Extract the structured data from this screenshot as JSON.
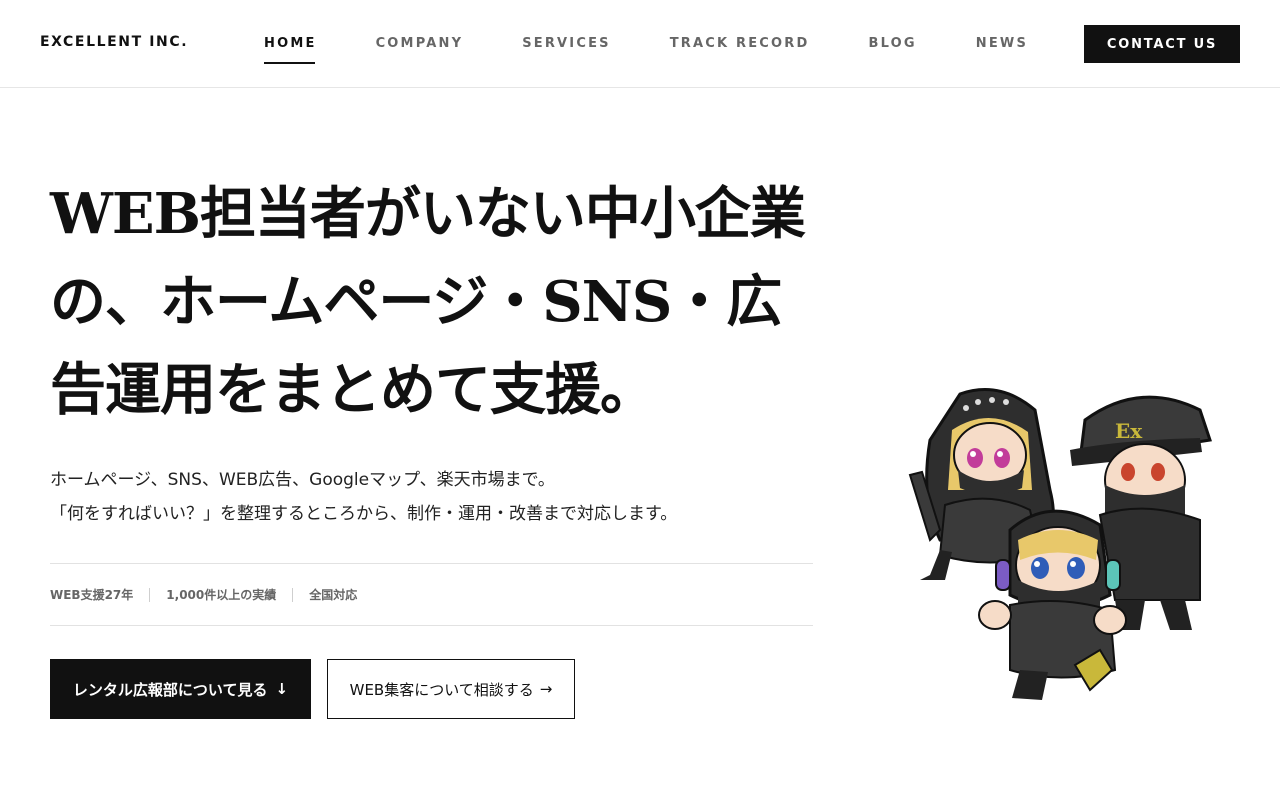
{
  "header": {
    "logo": "EXCELLENT INC.",
    "nav": [
      {
        "label": "HOME",
        "active": true
      },
      {
        "label": "COMPANY",
        "active": false
      },
      {
        "label": "SERVICES",
        "active": false
      },
      {
        "label": "TRACK RECORD",
        "active": false
      },
      {
        "label": "BLOG",
        "active": false
      },
      {
        "label": "NEWS",
        "active": false
      }
    ],
    "contact_label": "CONTACT US"
  },
  "hero": {
    "title_lines": [
      "WEB担当者がいない中小企業",
      "の、ホームページ・SNS・広",
      "告運用をまとめて支援。"
    ],
    "description_lines": [
      "ホームページ、SNS、WEB広告、Googleマップ、楽天市場まで。",
      "「何をすればいい？」を整理するところから、制作・運用・改善まで対応します。"
    ],
    "stats": [
      "WEB支援27年",
      "1,000件以上の実績",
      "全国対応"
    ],
    "primary_button": {
      "label": "レンタル広報部について見る",
      "icon": "arrow-down-icon",
      "glyph": "↓"
    },
    "secondary_button": {
      "label": "WEB集客について相談する",
      "icon": "arrow-right-icon",
      "glyph": "→"
    }
  },
  "illustration": {
    "badge_text": "Ex",
    "colors": {
      "hood": "#2e2e2e",
      "skin": "#f6dcc8",
      "accent": "#c9b83a",
      "hair": "#e8c86a",
      "eyes_pink": "#c23c9a",
      "eyes_blue": "#2f5db8",
      "eyes_red": "#c9452e"
    }
  }
}
